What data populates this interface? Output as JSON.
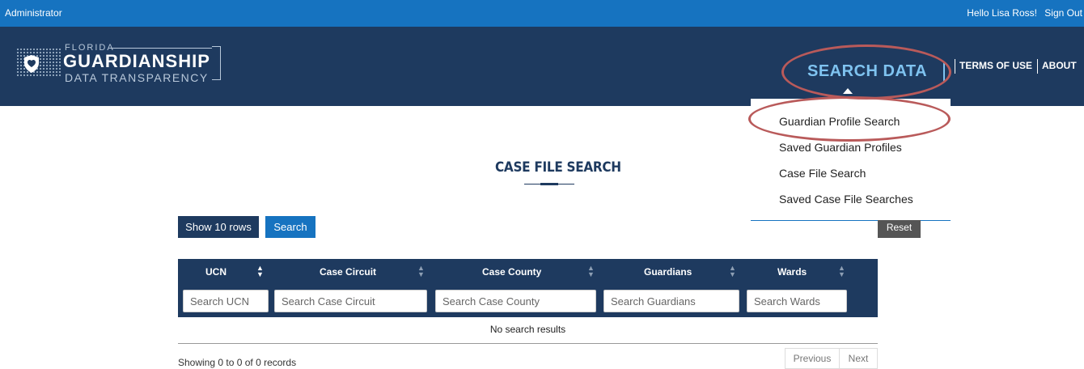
{
  "topbar": {
    "role": "Administrator",
    "greeting": "Hello Lisa Ross!",
    "signout": "Sign Out"
  },
  "logo": {
    "line1": "FLORIDA",
    "line2": "GUARDIANSHIP",
    "line3": "DATA TRANSPARENCY"
  },
  "nav": {
    "search_data": "SEARCH DATA",
    "terms": "TERMS OF USE",
    "about": "ABOUT"
  },
  "dropdown": {
    "items": [
      "Guardian Profile Search",
      "Saved Guardian Profiles",
      "Case File Search",
      "Saved Case File Searches"
    ]
  },
  "page": {
    "title": "CASE FILE SEARCH"
  },
  "controls": {
    "show_rows": "Show 10 rows",
    "search": "Search",
    "reset": "Reset"
  },
  "table": {
    "columns": [
      "UCN",
      "Case Circuit",
      "Case County",
      "Guardians",
      "Wards"
    ],
    "placeholders": [
      "Search UCN",
      "Search Case Circuit",
      "Search Case County",
      "Search Guardians",
      "Search Wards"
    ],
    "empty": "No search results"
  },
  "footer": {
    "info": "Showing 0 to 0 of 0 records",
    "previous": "Previous",
    "next": "Next"
  },
  "colors": {
    "topbar": "#1673c0",
    "header": "#1e3a5f",
    "accent": "#7fc3f0",
    "annotation": "#b95a5a"
  }
}
